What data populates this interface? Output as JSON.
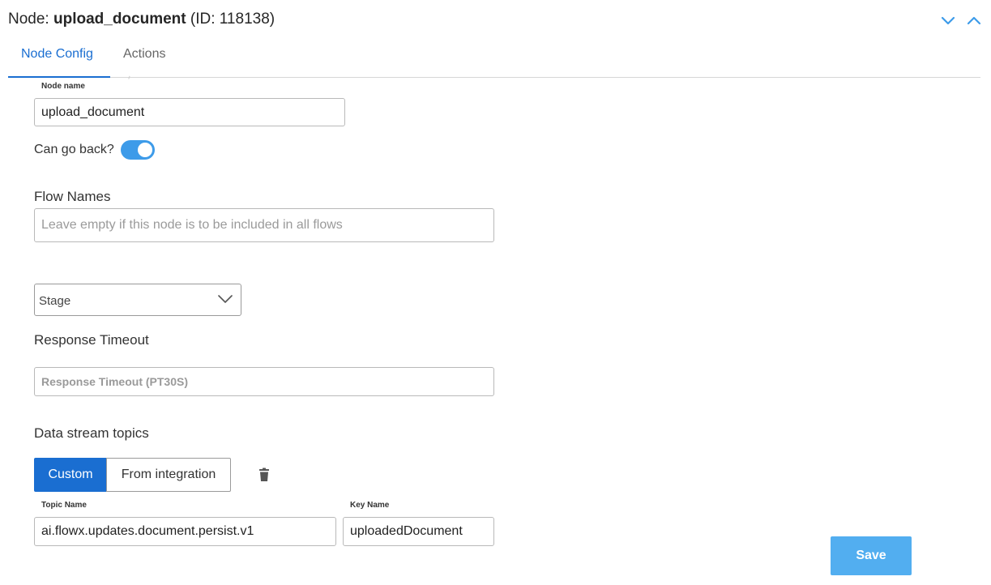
{
  "header": {
    "prefix": "Node:",
    "node_name": "upload_document",
    "id_text": "(ID: 118138)",
    "icons": [
      "chevron-down-icon",
      "chevron-up-icon"
    ],
    "accent_color": "#1a6ed1"
  },
  "tabs": [
    {
      "label": "Node Config",
      "active": true
    },
    {
      "label": "Actions",
      "active": false
    }
  ],
  "form": {
    "node_name": {
      "label": "Node name",
      "value": "upload_document"
    },
    "can_go_back": {
      "label": "Can go back?",
      "enabled": true
    },
    "flow_names": {
      "label": "Flow Names",
      "placeholder": "Leave empty if this node is to be included in all flows",
      "value": ""
    },
    "stage": {
      "placeholder": "Stage",
      "icon": "chevron-down-icon"
    },
    "response_timeout": {
      "label": "Response Timeout",
      "placeholder": "Response Timeout (PT30S)",
      "value": ""
    },
    "data_stream": {
      "label": "Data stream topics",
      "modes": [
        {
          "label": "Custom",
          "active": true
        },
        {
          "label": "From integration",
          "active": false
        }
      ],
      "delete_icon": "trash-icon",
      "topic_name": {
        "label": "Topic Name",
        "value": "ai.flowx.updates.document.persist.v1"
      },
      "key_name": {
        "label": "Key Name",
        "value": "uploadedDocument"
      }
    }
  },
  "save_button": {
    "label": "Save",
    "color": "#52aef0"
  }
}
